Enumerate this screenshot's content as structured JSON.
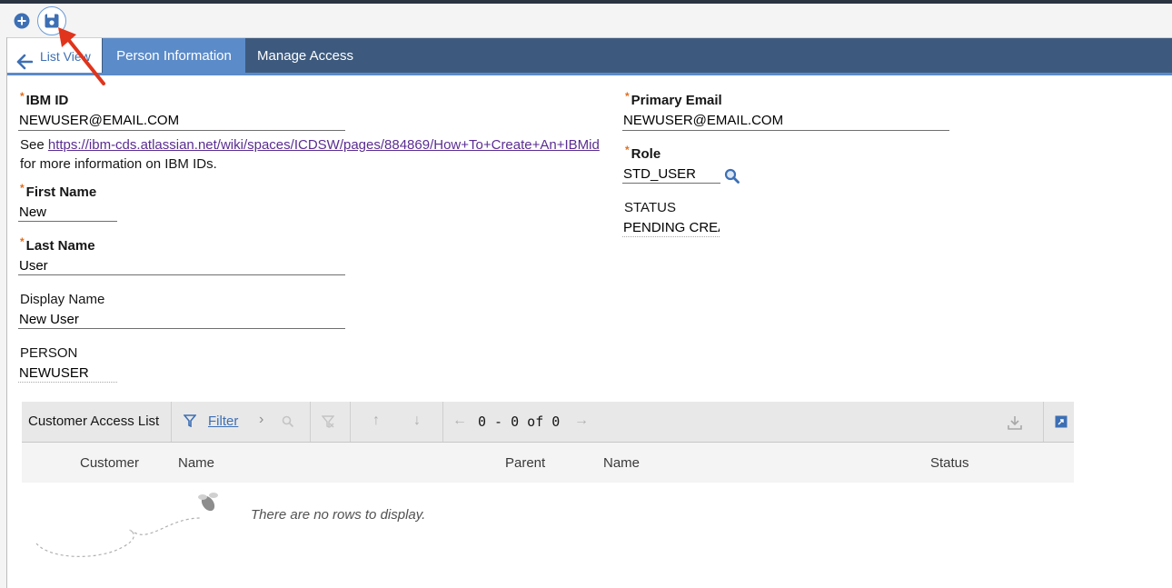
{
  "toolbar": {
    "new_icon": "plus-circle-icon",
    "save_icon": "save-icon"
  },
  "tabs": {
    "list_view": "List View",
    "person_information": "Person Information",
    "manage_access": "Manage Access"
  },
  "form": {
    "ibm_id": {
      "label": "IBM ID",
      "value": "NEWUSER@EMAIL.COM"
    },
    "ibm_id_note": {
      "prefix": "See",
      "link": "https://ibm-cds.atlassian.net/wiki/spaces/ICDSW/pages/884869/How+To+Create+An+IBMid",
      "suffix": "for more information on IBM IDs."
    },
    "first_name": {
      "label": "First Name",
      "value": "New"
    },
    "last_name": {
      "label": "Last Name",
      "value": "User"
    },
    "display_name": {
      "label": "Display Name",
      "value": "New User"
    },
    "person": {
      "label": "PERSON",
      "value": "NEWUSER"
    },
    "primary_email": {
      "label": "Primary Email",
      "value": "NEWUSER@EMAIL.COM"
    },
    "role": {
      "label": "Role",
      "value": "STD_USER"
    },
    "status": {
      "label": "STATUS",
      "value": "PENDING CREA"
    },
    "required_mark": "*"
  },
  "grid": {
    "title": "Customer Access List",
    "filter_label": "Filter",
    "range_text": "0 - 0 of 0",
    "columns": [
      "Customer",
      "Name",
      "Parent",
      "Name",
      "Status"
    ],
    "empty_message": "There are no rows to display."
  },
  "colors": {
    "nav_bg": "#3d5a7e",
    "nav_active": "#5b8bc9",
    "link": "#5a2d91",
    "required": "#e16f1f",
    "annotation_arrow": "#e0341c"
  }
}
